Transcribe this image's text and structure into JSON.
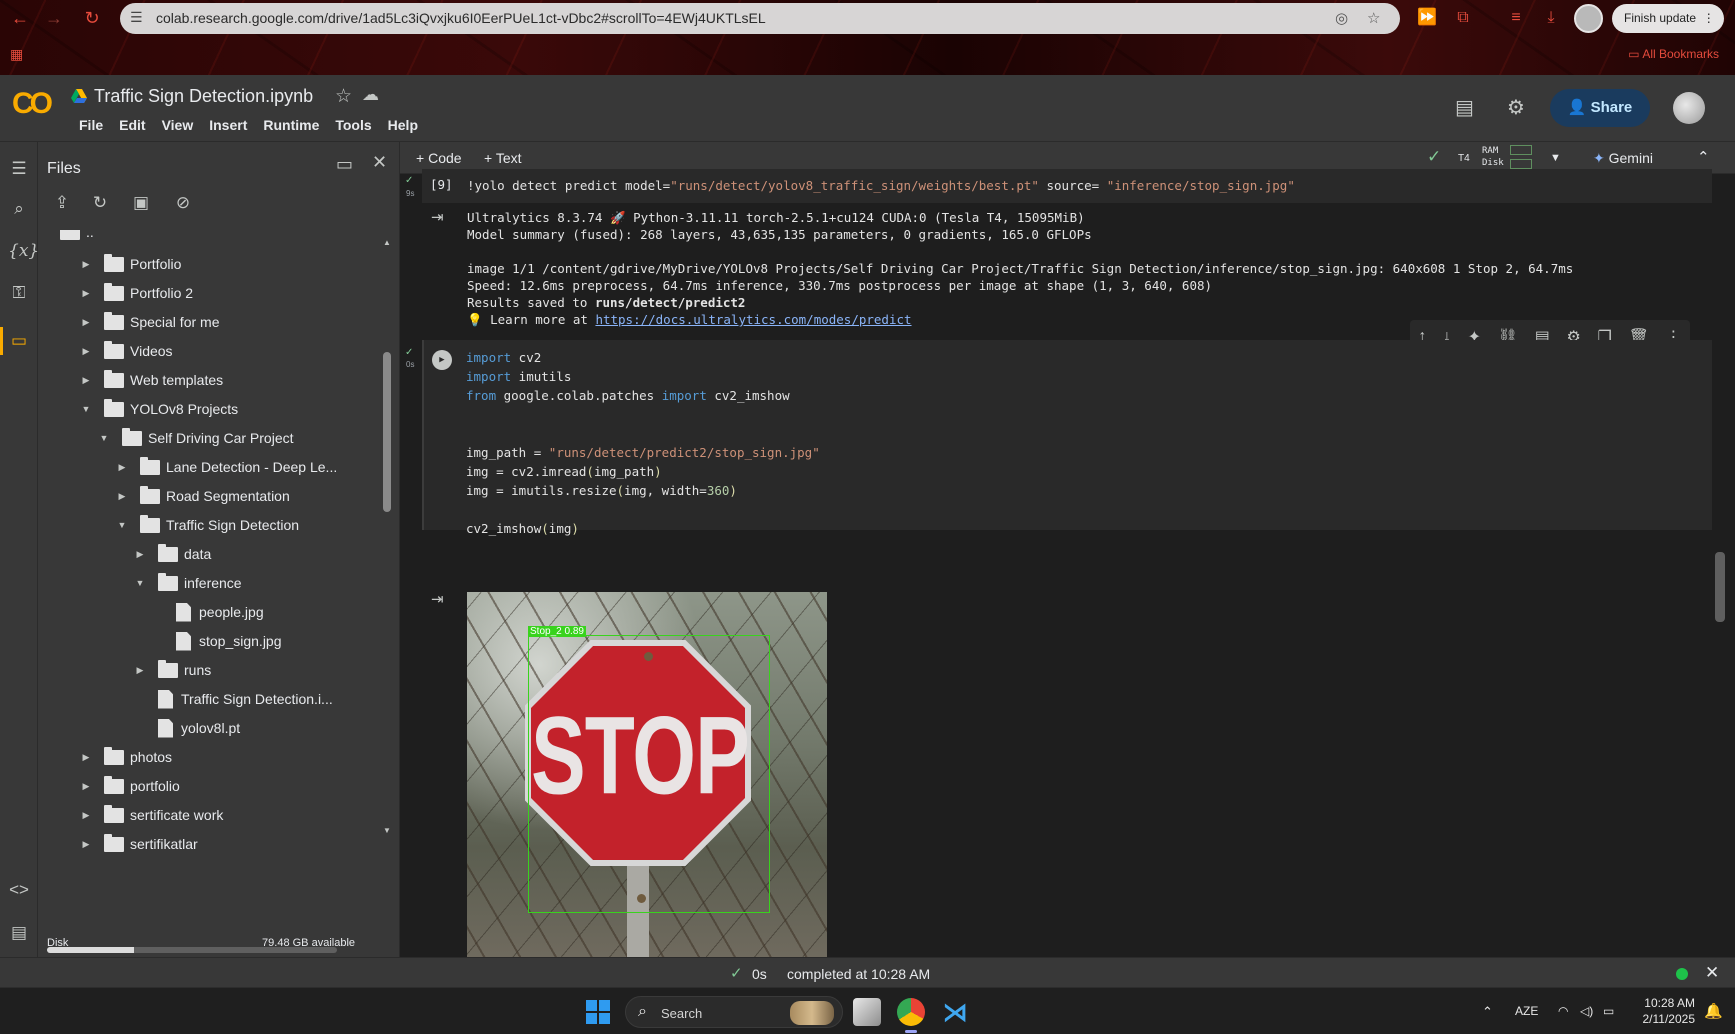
{
  "browser": {
    "url": "colab.research.google.com/drive/1ad5Lc3iQvxjku6I0EerPUeL1ct-vDbc2#scrollTo=4EWj4UKTLsEL",
    "finish_update": "Finish update",
    "all_bookmarks": "All Bookmarks"
  },
  "header": {
    "notebook_title": "Traffic Sign Detection.ipynb",
    "logo": "CO",
    "menu": [
      "File",
      "Edit",
      "View",
      "Insert",
      "Runtime",
      "Tools",
      "Help"
    ],
    "share_label": "Share"
  },
  "files_panel": {
    "title": "Files",
    "disk_label": "Disk",
    "disk_available": "79.48 GB available",
    "disk_used_fraction": 0.3,
    "tree": [
      {
        "label": "..",
        "kind": "up"
      },
      {
        "label": "Portfolio",
        "kind": "folder",
        "state": "collapsed"
      },
      {
        "label": "Portfolio 2",
        "kind": "folder",
        "state": "collapsed"
      },
      {
        "label": "Special for me",
        "kind": "folder",
        "state": "collapsed"
      },
      {
        "label": "Videos",
        "kind": "folder",
        "state": "collapsed"
      },
      {
        "label": "Web templates",
        "kind": "folder",
        "state": "collapsed"
      },
      {
        "label": "YOLOv8 Projects",
        "kind": "folder",
        "state": "expanded"
      },
      {
        "label": "Self Driving Car Project",
        "kind": "folder",
        "state": "expanded"
      },
      {
        "label": "Lane Detection - Deep Le...",
        "kind": "folder",
        "state": "collapsed"
      },
      {
        "label": "Road Segmentation",
        "kind": "folder",
        "state": "collapsed"
      },
      {
        "label": "Traffic Sign Detection",
        "kind": "folder",
        "state": "expanded"
      },
      {
        "label": "data",
        "kind": "folder",
        "state": "collapsed"
      },
      {
        "label": "inference",
        "kind": "folder",
        "state": "expanded"
      },
      {
        "label": "people.jpg",
        "kind": "file"
      },
      {
        "label": "stop_sign.jpg",
        "kind": "file"
      },
      {
        "label": "runs",
        "kind": "folder",
        "state": "collapsed"
      },
      {
        "label": "Traffic Sign Detection.i...",
        "kind": "file"
      },
      {
        "label": "yolov8l.pt",
        "kind": "file"
      },
      {
        "label": "photos",
        "kind": "folder",
        "state": "collapsed"
      },
      {
        "label": "portfolio",
        "kind": "folder",
        "state": "collapsed"
      },
      {
        "label": "sertificate work",
        "kind": "folder",
        "state": "collapsed"
      },
      {
        "label": "sertifikatlar",
        "kind": "folder",
        "state": "collapsed"
      }
    ]
  },
  "notebook_toolbar": {
    "code_label": "Code",
    "text_label": "Text",
    "runtime": "T4",
    "ram_label": "RAM",
    "disk_label": "Disk",
    "gemini_label": "Gemini"
  },
  "cell1": {
    "exec_count": "[9]",
    "run_time": "9s",
    "code": "!yolo detect predict model=\"runs/detect/yolov8_traffic_sign/weights/best.pt\" source= \"inference/stop_sign.jpg\"",
    "output": [
      "Ultralytics 8.3.74 🚀 Python-3.11.11 torch-2.5.1+cu124 CUDA:0 (Tesla T4, 15095MiB)",
      "Model summary (fused): 268 layers, 43,635,135 parameters, 0 gradients, 165.0 GFLOPs",
      "",
      "image 1/1 /content/gdrive/MyDrive/YOLOv8 Projects/Self Driving Car Project/Traffic Sign Detection/inference/stop_sign.jpg: 640x608 1 Stop 2, 64.7ms",
      "Speed: 12.6ms preprocess, 64.7ms inference, 330.7ms postprocess per image at shape (1, 3, 640, 608)"
    ],
    "results_prefix": "Results saved to ",
    "results_path": "runs/detect/predict2",
    "learn_more_prefix": "💡 Learn more at ",
    "learn_more_link": "https://docs.ultralytics.com/modes/predict"
  },
  "cell2": {
    "run_time": "0s",
    "detection_label": "Stop_2  0.89",
    "sign_text": "STOP"
  },
  "status": {
    "time": "0s",
    "text": "completed at 10:28 AM"
  },
  "taskbar": {
    "search_placeholder": "Search",
    "language": "AZE",
    "time": "10:28 AM",
    "date": "2/11/2025"
  },
  "colors": {
    "accent_orange": "#f9ab00",
    "share_bg": "#1a3b5e",
    "detection_green": "#39d31d",
    "stop_red": "#c3222b"
  }
}
